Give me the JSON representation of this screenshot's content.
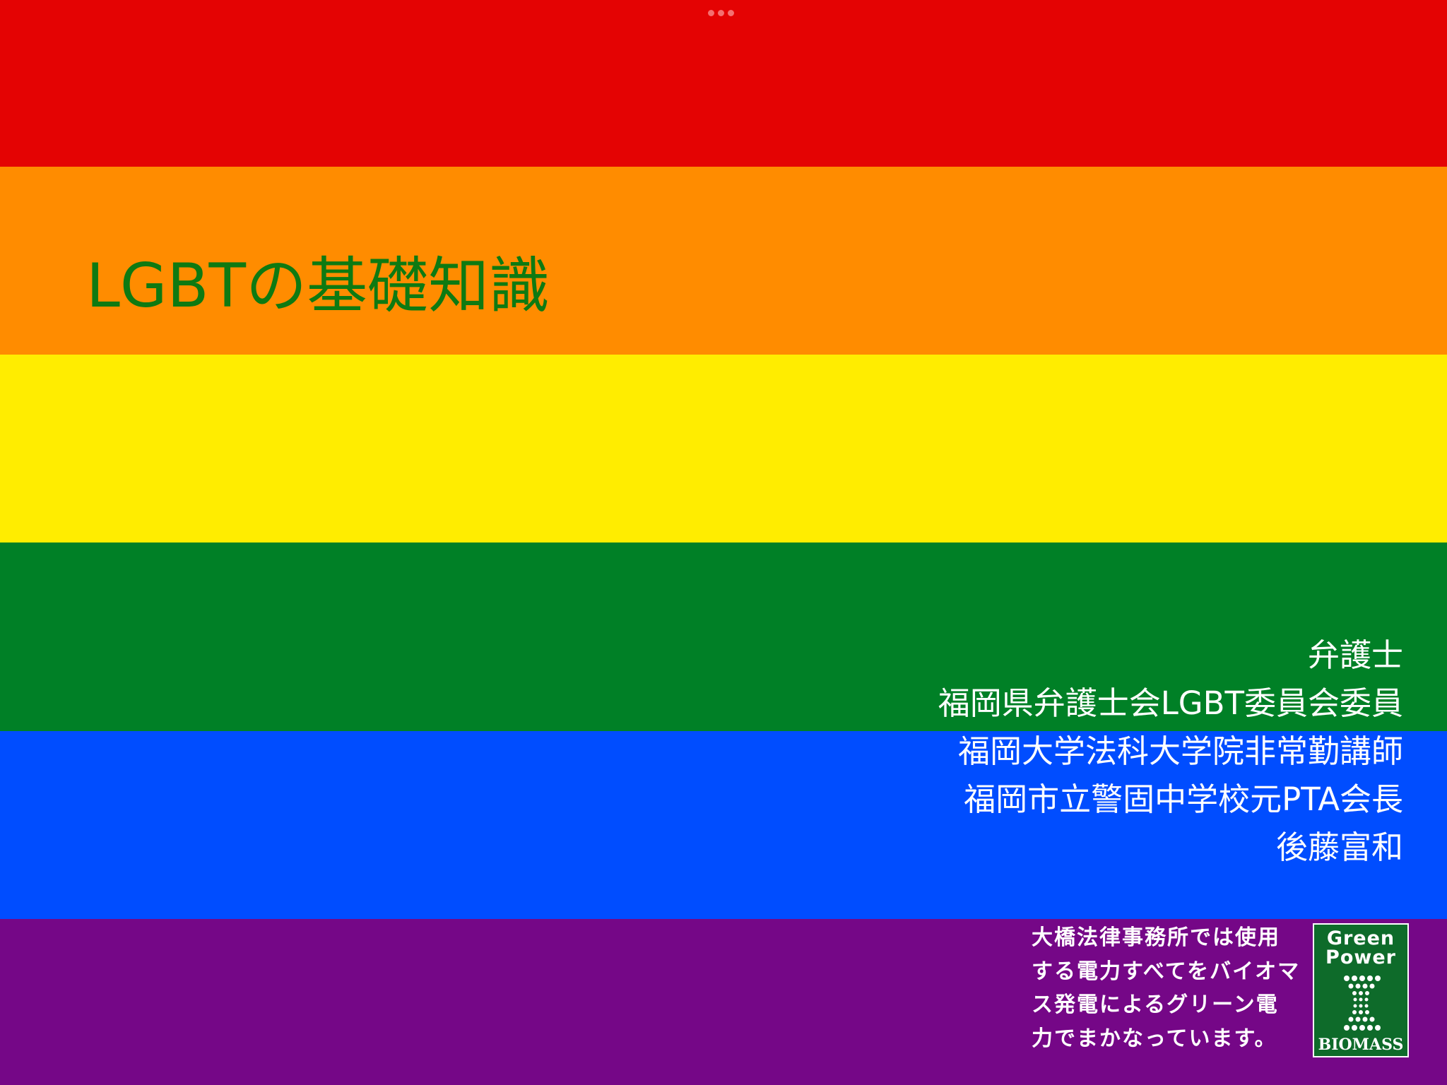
{
  "colors": {
    "red": "#E40303",
    "orange": "#FF8C00",
    "yellow": "#FFED00",
    "green": "#008026",
    "blue": "#004DFF",
    "purple": "#750787",
    "title_text": "#0E7A12",
    "logo_bg": "#0E6B2A"
  },
  "slide": {
    "title": "LGBTの基礎知識",
    "author_lines": [
      "弁護士",
      "福岡県弁護士会LGBT委員会委員",
      "福岡大学法科大学院非常勤講師",
      "福岡市立警固中学校元PTA会長",
      "後藤富和"
    ],
    "notice_lines": [
      "大橋法律事務所では使用",
      "する電力すべてをバイオマ",
      "ス発電によるグリーン電",
      "力でまかなっています。"
    ]
  },
  "logo": {
    "line1": "Green",
    "line2": "Power",
    "footer": "BIOMASS"
  },
  "icons": {
    "more": "ellipsis-icon",
    "logo_mark": "green-power-biomass-logo"
  }
}
